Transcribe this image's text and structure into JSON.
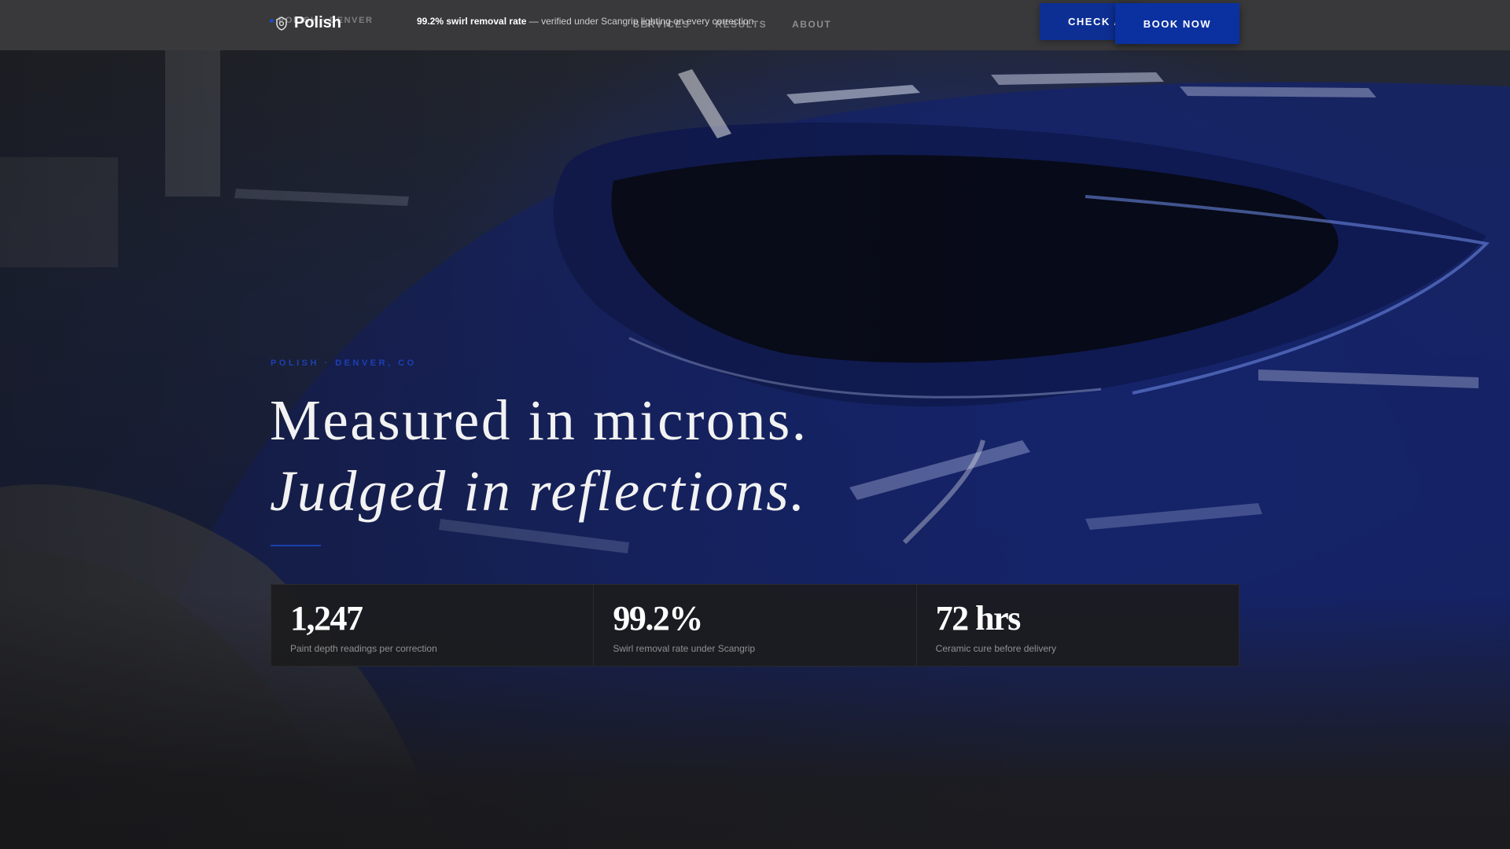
{
  "page": {
    "accent_color": "#0b31a0",
    "background_color": "#1c1c1f"
  },
  "topbar": {
    "ticker": "Polish · Denver",
    "brand": {
      "name": "Polish",
      "icon": "shield-icon"
    },
    "stat_banner": {
      "highlight": "99.2% swirl removal rate",
      "text": "— verified under Scangrip lighting on every correction"
    },
    "nav": [
      {
        "label": "SERVICES"
      },
      {
        "label": "RESULTS"
      },
      {
        "label": "ABOUT"
      }
    ],
    "check_button": "CHECK AVAILABILITY",
    "book_button": "BOOK NOW"
  },
  "hero": {
    "eyebrow": "POLISH · DENVER, CO",
    "headline_line1": "Measured in microns.",
    "headline_line2": "Judged in reflections."
  },
  "stats": [
    {
      "value": "1,247",
      "label": "Paint depth readings per correction"
    },
    {
      "value": "99.2%",
      "label": "Swirl removal rate under Scangrip"
    },
    {
      "value": "72 hrs",
      "label": "Ceramic cure before delivery"
    }
  ]
}
